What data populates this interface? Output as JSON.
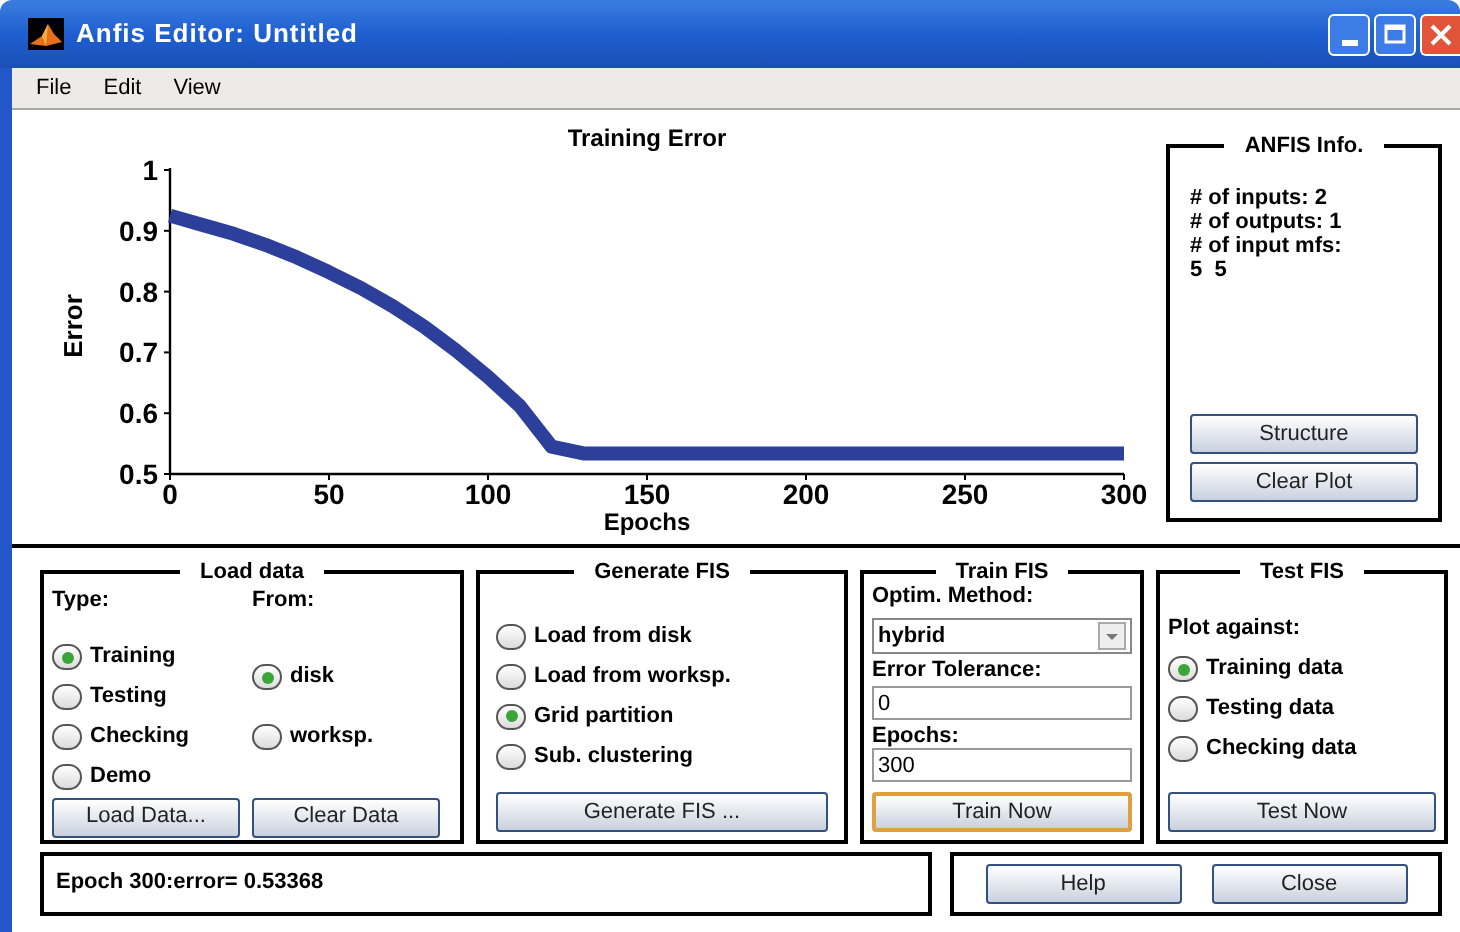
{
  "window": {
    "title": "Anfis Editor: Untitled"
  },
  "menu": [
    "File",
    "Edit",
    "View"
  ],
  "plot": {
    "chart_data": {
      "type": "line",
      "title": "Training Error",
      "xlabel": "Epochs",
      "ylabel": "Error",
      "x": [
        0,
        10,
        20,
        30,
        40,
        50,
        60,
        70,
        80,
        90,
        100,
        110,
        120,
        130,
        150,
        200,
        250,
        300
      ],
      "series": [
        {
          "color": "#2b3f9b",
          "values": [
            0.925,
            0.91,
            0.895,
            0.877,
            0.856,
            0.832,
            0.806,
            0.776,
            0.742,
            0.703,
            0.66,
            0.612,
            0.545,
            0.534,
            0.534,
            0.534,
            0.534,
            0.534
          ]
        }
      ],
      "xlim": [
        0,
        300
      ],
      "ylim": [
        0.5,
        1
      ],
      "xticks": [
        0,
        50,
        100,
        150,
        200,
        250,
        300
      ],
      "yticks": [
        0.5,
        0.6,
        0.7,
        0.8,
        0.9,
        1
      ]
    }
  },
  "anfis_info": {
    "title": "ANFIS Info.",
    "lines": [
      "# of inputs: 2",
      "# of outputs: 1",
      "# of input mfs:",
      "5  5"
    ],
    "buttons": [
      "Structure",
      "Clear Plot"
    ]
  },
  "load_data": {
    "title": "Load data",
    "type_label": "Type:",
    "from_label": "From:",
    "types": [
      {
        "label": "Training",
        "selected": true
      },
      {
        "label": "Testing",
        "selected": false
      },
      {
        "label": "Checking",
        "selected": false
      },
      {
        "label": "Demo",
        "selected": false
      }
    ],
    "sources": [
      {
        "label": "disk",
        "selected": true
      },
      {
        "label": "worksp.",
        "selected": false
      }
    ],
    "buttons": [
      "Load Data...",
      "Clear Data"
    ]
  },
  "generate_fis": {
    "title": "Generate FIS",
    "options": [
      {
        "label": "Load from disk",
        "selected": false
      },
      {
        "label": "Load from worksp.",
        "selected": false
      },
      {
        "label": "Grid partition",
        "selected": true
      },
      {
        "label": "Sub. clustering",
        "selected": false
      }
    ],
    "button": "Generate FIS ..."
  },
  "train_fis": {
    "title": "Train FIS",
    "method_label": "Optim. Method:",
    "method": "hybrid",
    "tolerance_label": "Error Tolerance:",
    "tolerance": "0",
    "epochs_label": "Epochs:",
    "epochs": "300",
    "button": {
      "label": "Train Now",
      "focused": true
    }
  },
  "test_fis": {
    "title": "Test FIS",
    "plot_label": "Plot against:",
    "options": [
      {
        "label": "Training data",
        "selected": true
      },
      {
        "label": "Testing data",
        "selected": false
      },
      {
        "label": "Checking data",
        "selected": false
      }
    ],
    "button": "Test Now"
  },
  "status": "Epoch 300:error= 0.53368",
  "buttons": [
    "Help",
    "Close"
  ]
}
